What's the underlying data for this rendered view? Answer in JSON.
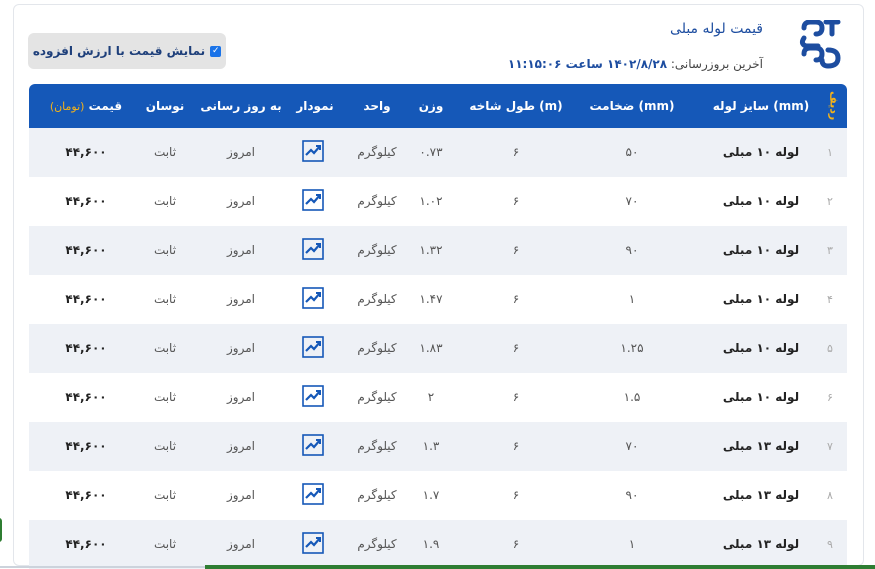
{
  "header": {
    "title": "قیمت لوله مبلی",
    "updated_label": "آخرین بروزرسانی:",
    "updated_value": "۱۴۰۲/۸/۲۸ ساعت ۱۱:۱۵:۰۶"
  },
  "vat_toggle": {
    "label": "نمایش قیمت با ارزش افزوده",
    "checked": true
  },
  "table": {
    "columns": {
      "radif": "ردیف",
      "size": "سایز لوله (mm)",
      "thickness": "ضخامت (mm)",
      "length": "طول شاخه (m)",
      "weight": "وزن",
      "unit": "واحد",
      "chart": "نمودار",
      "updated": "به روز رسانی",
      "change": "نوسان",
      "price": "قیمت",
      "price_unit": "(تومان)"
    },
    "rows": [
      {
        "idx": "۱",
        "size": "لوله ۱۰ مبلی",
        "thickness": "۵۰",
        "length": "۶",
        "weight": "۰.۷۳",
        "unit": "کیلوگرم",
        "updated": "امروز",
        "change": "ثابت",
        "price": "۴۴,۶۰۰"
      },
      {
        "idx": "۲",
        "size": "لوله ۱۰ مبلی",
        "thickness": "۷۰",
        "length": "۶",
        "weight": "۱.۰۲",
        "unit": "کیلوگرم",
        "updated": "امروز",
        "change": "ثابت",
        "price": "۴۴,۶۰۰"
      },
      {
        "idx": "۳",
        "size": "لوله ۱۰ مبلی",
        "thickness": "۹۰",
        "length": "۶",
        "weight": "۱.۳۲",
        "unit": "کیلوگرم",
        "updated": "امروز",
        "change": "ثابت",
        "price": "۴۴,۶۰۰"
      },
      {
        "idx": "۴",
        "size": "لوله ۱۰ مبلی",
        "thickness": "۱",
        "length": "۶",
        "weight": "۱.۴۷",
        "unit": "کیلوگرم",
        "updated": "امروز",
        "change": "ثابت",
        "price": "۴۴,۶۰۰"
      },
      {
        "idx": "۵",
        "size": "لوله ۱۰ مبلی",
        "thickness": "۱.۲۵",
        "length": "۶",
        "weight": "۱.۸۳",
        "unit": "کیلوگرم",
        "updated": "امروز",
        "change": "ثابت",
        "price": "۴۴,۶۰۰"
      },
      {
        "idx": "۶",
        "size": "لوله ۱۰ مبلی",
        "thickness": "۱.۵",
        "length": "۶",
        "weight": "۲",
        "unit": "کیلوگرم",
        "updated": "امروز",
        "change": "ثابت",
        "price": "۴۴,۶۰۰"
      },
      {
        "idx": "۷",
        "size": "لوله ۱۳ مبلی",
        "thickness": "۷۰",
        "length": "۶",
        "weight": "۱.۳",
        "unit": "کیلوگرم",
        "updated": "امروز",
        "change": "ثابت",
        "price": "۴۴,۶۰۰"
      },
      {
        "idx": "۸",
        "size": "لوله ۱۳ مبلی",
        "thickness": "۹۰",
        "length": "۶",
        "weight": "۱.۷",
        "unit": "کیلوگرم",
        "updated": "امروز",
        "change": "ثابت",
        "price": "۴۴,۶۰۰"
      },
      {
        "idx": "۹",
        "size": "لوله ۱۳ مبلی",
        "thickness": "۱",
        "length": "۶",
        "weight": "۱.۹",
        "unit": "کیلوگرم",
        "updated": "امروز",
        "change": "ثابت",
        "price": "۴۴,۶۰۰"
      }
    ]
  },
  "colors": {
    "header_bg": "#1558b8",
    "row_shade": "#eef1f6",
    "accent": "#f3b21a",
    "brand": "#1d4da0"
  },
  "icons": {
    "chart": "trend-chart-icon",
    "logo": "brand-logo"
  }
}
